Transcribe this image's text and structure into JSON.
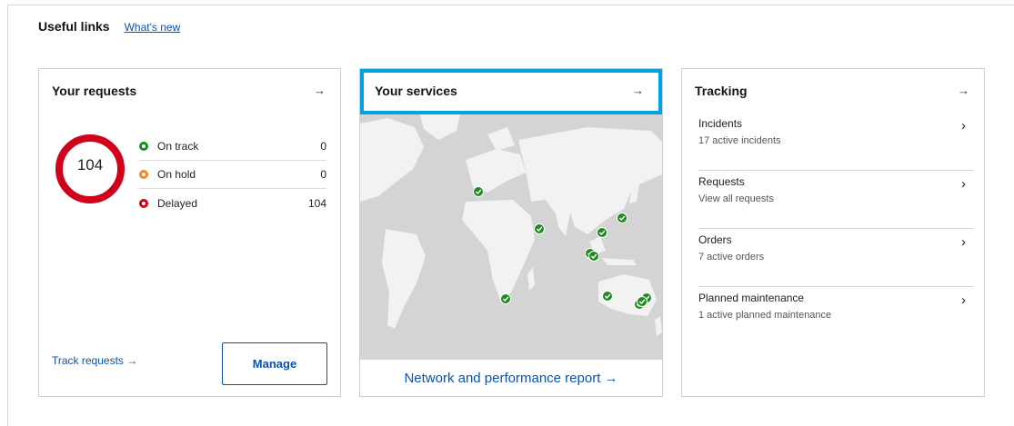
{
  "useful_links": {
    "title": "Useful links",
    "whats_new": "What's new"
  },
  "requests": {
    "title": "Your requests",
    "total": "104",
    "statuses": [
      {
        "label": "On track",
        "count": "0",
        "color": "#1f8a1f"
      },
      {
        "label": "On hold",
        "count": "0",
        "color": "#f08a24"
      },
      {
        "label": "Delayed",
        "count": "104",
        "color": "#d0021b"
      }
    ],
    "track_link": "Track requests",
    "manage_button": "Manage",
    "ring_color": "#d0021b"
  },
  "services": {
    "title": "Your services",
    "report_link": "Network and performance report",
    "marker_color": "#1f8a1f"
  },
  "tracking": {
    "title": "Tracking",
    "items": [
      {
        "title": "Incidents",
        "subtitle": "17 active incidents"
      },
      {
        "title": "Requests",
        "subtitle": "View all requests"
      },
      {
        "title": "Orders",
        "subtitle": "7 active orders"
      },
      {
        "title": "Planned maintenance",
        "subtitle": "1 active planned maintenance"
      }
    ]
  },
  "icons": {
    "card_arrow": "arrow-right-icon",
    "item_chevron": "chevron-right-icon"
  }
}
